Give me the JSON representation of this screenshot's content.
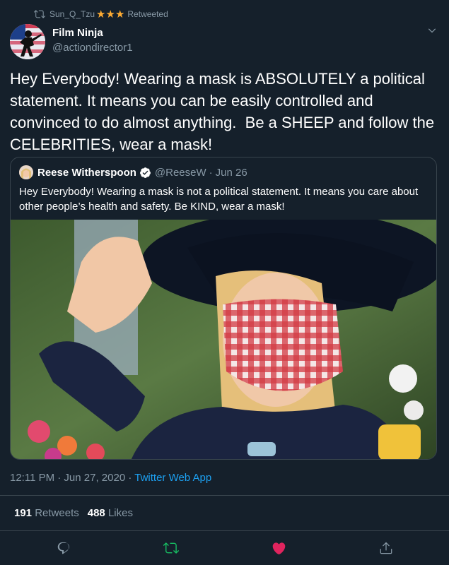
{
  "retweet": {
    "user": "Sun_Q_Tzu",
    "stars": "★★★",
    "label": "Retweeted"
  },
  "author": {
    "name": "Film Ninja",
    "handle": "@actiondirector1"
  },
  "tweet": {
    "text": "Hey Everybody! Wearing a mask is ABSOLUTELY a political statement. It means you can be easily controlled and convinced to do almost anything.  Be a SHEEP and follow the CELEBRITIES, wear a mask!"
  },
  "quote": {
    "name": "Reese Witherspoon",
    "handle": "@ReeseW",
    "dot": "·",
    "date": "Jun 26",
    "text": "Hey Everybody! Wearing a mask is not a political statement. It means you care about other people’s health and safety. Be KIND, wear a mask!"
  },
  "meta": {
    "time": "12:11 PM · Jun 27, 2020 · ",
    "source": "Twitter Web App"
  },
  "stats": {
    "retweets_count": "191",
    "retweets_label": "Retweets",
    "likes_count": "488",
    "likes_label": "Likes"
  },
  "colors": {
    "background": "#15202b",
    "muted": "#8899a6",
    "link": "#1da1f2",
    "retweet_active": "#17bf63",
    "like_active": "#e0245e",
    "border": "#38444d"
  },
  "icons": [
    "retweet-icon",
    "caret-down-icon",
    "verified-icon",
    "reply-icon",
    "retweet-action-icon",
    "like-icon",
    "share-icon"
  ]
}
